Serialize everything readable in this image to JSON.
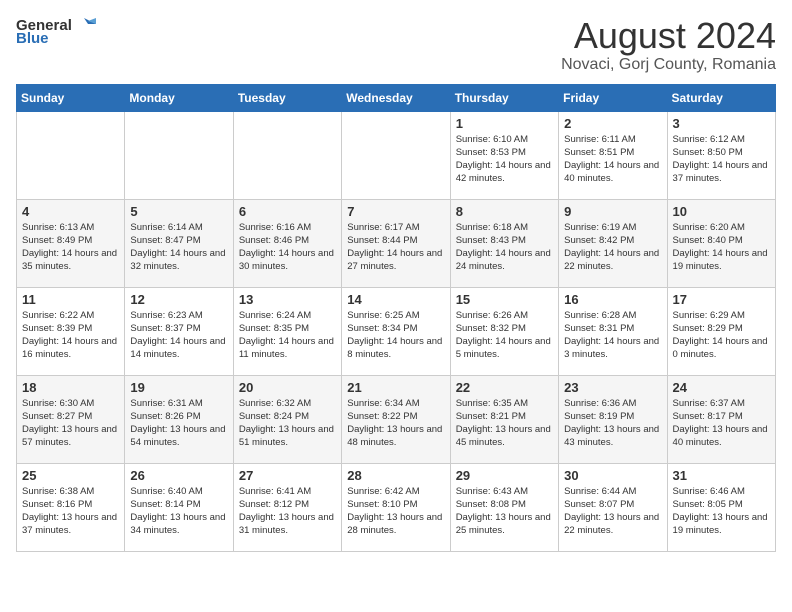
{
  "logo": {
    "general": "General",
    "blue": "Blue"
  },
  "header": {
    "month_year": "August 2024",
    "location": "Novaci, Gorj County, Romania"
  },
  "days_of_week": [
    "Sunday",
    "Monday",
    "Tuesday",
    "Wednesday",
    "Thursday",
    "Friday",
    "Saturday"
  ],
  "weeks": [
    [
      {
        "day": "",
        "info": ""
      },
      {
        "day": "",
        "info": ""
      },
      {
        "day": "",
        "info": ""
      },
      {
        "day": "",
        "info": ""
      },
      {
        "day": "1",
        "info": "Sunrise: 6:10 AM\nSunset: 8:53 PM\nDaylight: 14 hours\nand 42 minutes."
      },
      {
        "day": "2",
        "info": "Sunrise: 6:11 AM\nSunset: 8:51 PM\nDaylight: 14 hours\nand 40 minutes."
      },
      {
        "day": "3",
        "info": "Sunrise: 6:12 AM\nSunset: 8:50 PM\nDaylight: 14 hours\nand 37 minutes."
      }
    ],
    [
      {
        "day": "4",
        "info": "Sunrise: 6:13 AM\nSunset: 8:49 PM\nDaylight: 14 hours\nand 35 minutes."
      },
      {
        "day": "5",
        "info": "Sunrise: 6:14 AM\nSunset: 8:47 PM\nDaylight: 14 hours\nand 32 minutes."
      },
      {
        "day": "6",
        "info": "Sunrise: 6:16 AM\nSunset: 8:46 PM\nDaylight: 14 hours\nand 30 minutes."
      },
      {
        "day": "7",
        "info": "Sunrise: 6:17 AM\nSunset: 8:44 PM\nDaylight: 14 hours\nand 27 minutes."
      },
      {
        "day": "8",
        "info": "Sunrise: 6:18 AM\nSunset: 8:43 PM\nDaylight: 14 hours\nand 24 minutes."
      },
      {
        "day": "9",
        "info": "Sunrise: 6:19 AM\nSunset: 8:42 PM\nDaylight: 14 hours\nand 22 minutes."
      },
      {
        "day": "10",
        "info": "Sunrise: 6:20 AM\nSunset: 8:40 PM\nDaylight: 14 hours\nand 19 minutes."
      }
    ],
    [
      {
        "day": "11",
        "info": "Sunrise: 6:22 AM\nSunset: 8:39 PM\nDaylight: 14 hours\nand 16 minutes."
      },
      {
        "day": "12",
        "info": "Sunrise: 6:23 AM\nSunset: 8:37 PM\nDaylight: 14 hours\nand 14 minutes."
      },
      {
        "day": "13",
        "info": "Sunrise: 6:24 AM\nSunset: 8:35 PM\nDaylight: 14 hours\nand 11 minutes."
      },
      {
        "day": "14",
        "info": "Sunrise: 6:25 AM\nSunset: 8:34 PM\nDaylight: 14 hours\nand 8 minutes."
      },
      {
        "day": "15",
        "info": "Sunrise: 6:26 AM\nSunset: 8:32 PM\nDaylight: 14 hours\nand 5 minutes."
      },
      {
        "day": "16",
        "info": "Sunrise: 6:28 AM\nSunset: 8:31 PM\nDaylight: 14 hours\nand 3 minutes."
      },
      {
        "day": "17",
        "info": "Sunrise: 6:29 AM\nSunset: 8:29 PM\nDaylight: 14 hours\nand 0 minutes."
      }
    ],
    [
      {
        "day": "18",
        "info": "Sunrise: 6:30 AM\nSunset: 8:27 PM\nDaylight: 13 hours\nand 57 minutes."
      },
      {
        "day": "19",
        "info": "Sunrise: 6:31 AM\nSunset: 8:26 PM\nDaylight: 13 hours\nand 54 minutes."
      },
      {
        "day": "20",
        "info": "Sunrise: 6:32 AM\nSunset: 8:24 PM\nDaylight: 13 hours\nand 51 minutes."
      },
      {
        "day": "21",
        "info": "Sunrise: 6:34 AM\nSunset: 8:22 PM\nDaylight: 13 hours\nand 48 minutes."
      },
      {
        "day": "22",
        "info": "Sunrise: 6:35 AM\nSunset: 8:21 PM\nDaylight: 13 hours\nand 45 minutes."
      },
      {
        "day": "23",
        "info": "Sunrise: 6:36 AM\nSunset: 8:19 PM\nDaylight: 13 hours\nand 43 minutes."
      },
      {
        "day": "24",
        "info": "Sunrise: 6:37 AM\nSunset: 8:17 PM\nDaylight: 13 hours\nand 40 minutes."
      }
    ],
    [
      {
        "day": "25",
        "info": "Sunrise: 6:38 AM\nSunset: 8:16 PM\nDaylight: 13 hours\nand 37 minutes."
      },
      {
        "day": "26",
        "info": "Sunrise: 6:40 AM\nSunset: 8:14 PM\nDaylight: 13 hours\nand 34 minutes."
      },
      {
        "day": "27",
        "info": "Sunrise: 6:41 AM\nSunset: 8:12 PM\nDaylight: 13 hours\nand 31 minutes."
      },
      {
        "day": "28",
        "info": "Sunrise: 6:42 AM\nSunset: 8:10 PM\nDaylight: 13 hours\nand 28 minutes."
      },
      {
        "day": "29",
        "info": "Sunrise: 6:43 AM\nSunset: 8:08 PM\nDaylight: 13 hours\nand 25 minutes."
      },
      {
        "day": "30",
        "info": "Sunrise: 6:44 AM\nSunset: 8:07 PM\nDaylight: 13 hours\nand 22 minutes."
      },
      {
        "day": "31",
        "info": "Sunrise: 6:46 AM\nSunset: 8:05 PM\nDaylight: 13 hours\nand 19 minutes."
      }
    ]
  ],
  "colors": {
    "header_bg": "#2a6eb5",
    "accent": "#2a6eb5"
  }
}
